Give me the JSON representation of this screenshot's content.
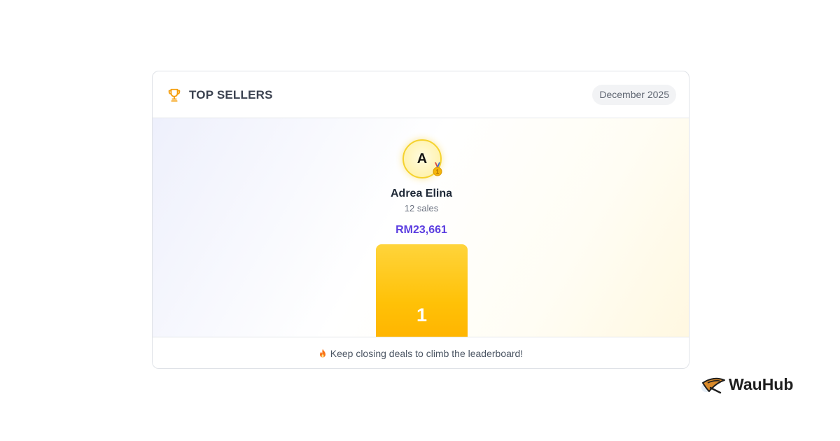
{
  "card": {
    "icon": "trophy-icon",
    "title": "TOP SELLERS",
    "period": "December 2025"
  },
  "leaderboard": [
    {
      "rank": "1",
      "initial": "A",
      "name": "Adrea Elina",
      "sales": "12 sales",
      "amount": "RM23,661",
      "medal": "gold-medal-icon"
    }
  ],
  "footer": {
    "icon": "fire-icon",
    "message": "Keep closing deals to climb the leaderboard!"
  },
  "brand": {
    "name": "WauHub",
    "logo": "wauhub-logo-icon"
  },
  "colors": {
    "accent_amount": "#5b3de0",
    "podium_gold": "#ffc107",
    "trophy": "#f59e0b"
  }
}
